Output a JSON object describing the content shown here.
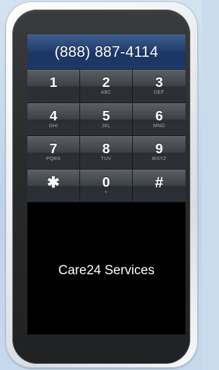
{
  "phone_number": "(888) 887-4114",
  "keypad": {
    "keys": [
      {
        "digit": "1",
        "letters": ""
      },
      {
        "digit": "2",
        "letters": "ABC"
      },
      {
        "digit": "3",
        "letters": "DEF"
      },
      {
        "digit": "4",
        "letters": "GHI"
      },
      {
        "digit": "5",
        "letters": "JKL"
      },
      {
        "digit": "6",
        "letters": "MNO"
      },
      {
        "digit": "7",
        "letters": "PQRS"
      },
      {
        "digit": "8",
        "letters": "TUV"
      },
      {
        "digit": "9",
        "letters": "WXYZ"
      },
      {
        "digit": "✱",
        "letters": ""
      },
      {
        "digit": "0",
        "letters": "+"
      },
      {
        "digit": "#",
        "letters": ""
      }
    ]
  },
  "caption": "Care24 Services",
  "colors": {
    "number_bar": "#1f3b6a",
    "keypad": "#3c4047",
    "screen": "#000000",
    "background": "#c9dbec"
  }
}
